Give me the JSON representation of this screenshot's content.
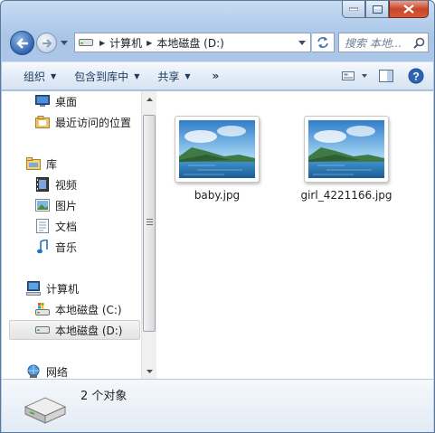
{
  "window": {
    "caption_buttons": [
      "minimize-icon",
      "maximize-icon",
      "close-icon"
    ]
  },
  "address_bar": {
    "crumbs": [
      "计算机",
      "本地磁盘 (D:)"
    ]
  },
  "search": {
    "placeholder": "搜索 本地..."
  },
  "toolbar": {
    "organize": "组织",
    "include_in_library": "包含到库中",
    "share": "共享",
    "more": "»"
  },
  "nav": {
    "desktop": "桌面",
    "recent": "最近访问的位置",
    "libraries": "库",
    "videos": "视频",
    "pictures": "图片",
    "documents": "文档",
    "music": "音乐",
    "computer": "计算机",
    "drive_c": "本地磁盘 (C:)",
    "drive_d": "本地磁盘 (D:)",
    "network": "网络"
  },
  "files": [
    {
      "name": "baby.jpg"
    },
    {
      "name": "girl_4221166.jpg"
    }
  ],
  "details": {
    "count_text": "2 个对象"
  },
  "colors": {
    "accent": "#2e64b0",
    "toolbar_text": "#1e395b",
    "sky": "#5aa3d8",
    "sea": "#2f7fb8"
  }
}
